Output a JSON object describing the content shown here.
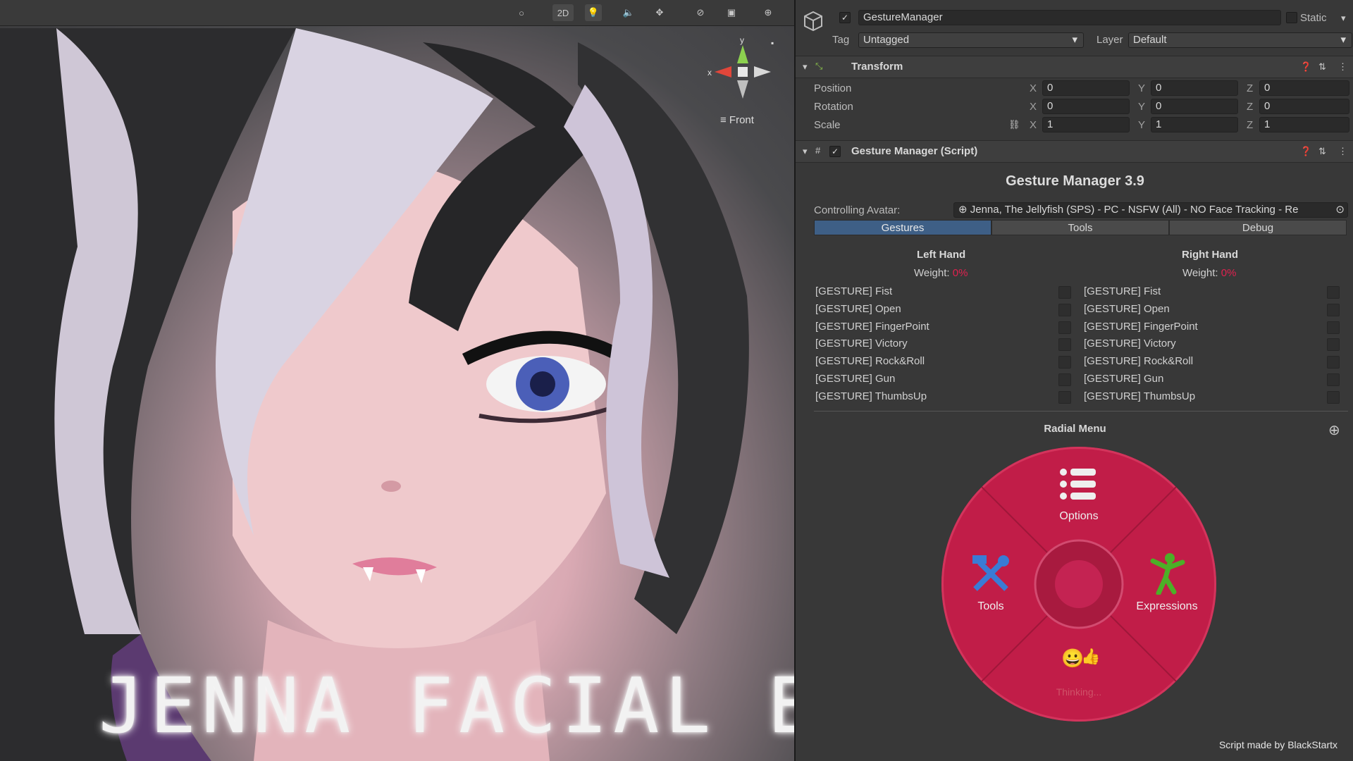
{
  "scene": {
    "toolbar": {
      "shading": "○",
      "mode_2d": "2D",
      "light": "💡",
      "audio": "🔈",
      "fx": "✥",
      "hidden": "⊘",
      "camera": "▣",
      "gizmos": "⊕"
    },
    "gizmo": {
      "y": "y",
      "x": "x",
      "view_label": "Front"
    },
    "overlay_title": "JENNA FACIAL EXPRESSIONS",
    "credit": "Script made by BlackStartx"
  },
  "inspector": {
    "object_name": "GestureManager",
    "static_label": "Static",
    "tag_label": "Tag",
    "tag_value": "Untagged",
    "layer_label": "Layer",
    "layer_value": "Default",
    "transform": {
      "title": "Transform",
      "rows": [
        {
          "label": "Position",
          "x": "0",
          "y": "0",
          "z": "0"
        },
        {
          "label": "Rotation",
          "x": "0",
          "y": "0",
          "z": "0"
        },
        {
          "label": "Scale",
          "x": "1",
          "y": "1",
          "z": "1"
        }
      ],
      "axis_x": "X",
      "axis_y": "Y",
      "axis_z": "Z"
    },
    "script": {
      "title": "Gesture Manager (Script)",
      "heading": "Gesture Manager 3.9",
      "controlling_label": "Controlling Avatar:",
      "controlling_value": "Jenna, The Jellyfish (SPS) - PC -  NSFW (All) - NO Face Tracking - Re",
      "tabs": [
        "Gestures",
        "Tools",
        "Debug"
      ],
      "left_hand": {
        "title": "Left Hand",
        "weight_label": "Weight:",
        "weight_value": "0%"
      },
      "right_hand": {
        "title": "Right Hand",
        "weight_label": "Weight:",
        "weight_value": "0%"
      },
      "gestures": [
        "[GESTURE] Fist",
        "[GESTURE] Open",
        "[GESTURE] FingerPoint",
        "[GESTURE] Victory",
        "[GESTURE] Rock&Roll",
        "[GESTURE] Gun",
        "[GESTURE] ThumbsUp"
      ],
      "radial_title": "Radial Menu",
      "radial": {
        "options": "Options",
        "tools": "Tools",
        "expressions": "Expressions",
        "bottom_faint": "Thinking..."
      }
    }
  }
}
